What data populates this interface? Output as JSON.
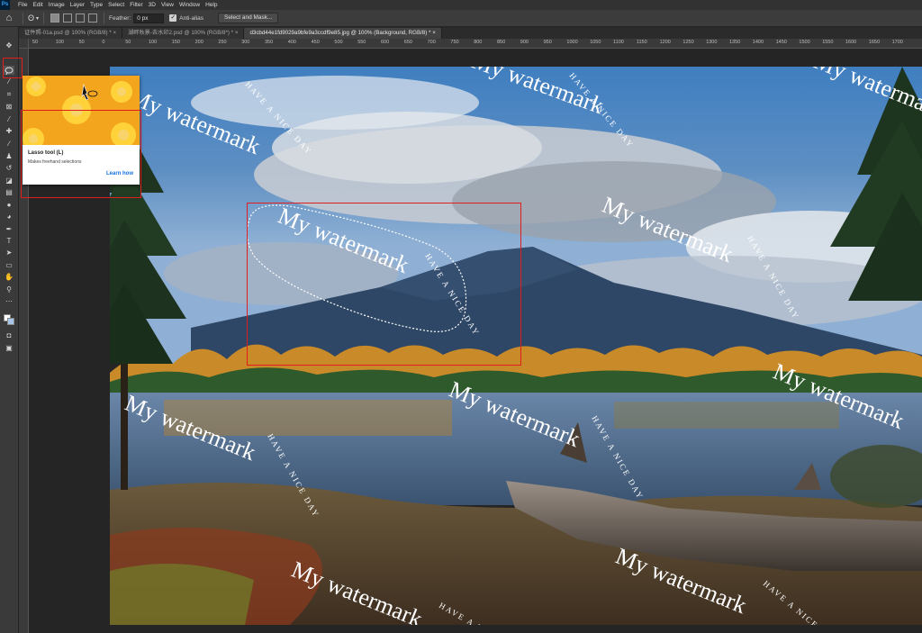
{
  "menubar": {
    "logo": "Ps",
    "items": [
      "File",
      "Edit",
      "Image",
      "Layer",
      "Type",
      "Select",
      "Filter",
      "3D",
      "View",
      "Window",
      "Help"
    ]
  },
  "options": {
    "feather_label": "Feather:",
    "feather_value": "0 px",
    "antialias_checked": true,
    "antialias_label": "Anti-alias",
    "select_mask_label": "Select and Mask..."
  },
  "tabs": [
    {
      "label": "证件照-01a.psd @ 100% (RGB/8) *",
      "active": false
    },
    {
      "label": "湖畔秋景-去水印2.psd @ 100% (RGB/8*) *",
      "active": false
    },
    {
      "label": "d3cbd44e1fd9029a9bfe9a3ccdf9e85.jpg @ 100% (Background, RGB/8) *",
      "active": true
    }
  ],
  "ruler_top": [
    "50",
    "100",
    "50",
    "0",
    "50",
    "100",
    "150",
    "200",
    "250",
    "300",
    "350",
    "400",
    "450",
    "500",
    "550",
    "600",
    "650",
    "700",
    "750",
    "800",
    "850",
    "900",
    "950",
    "1000",
    "1050",
    "1100",
    "1150",
    "1200",
    "1250",
    "1300",
    "1350",
    "1400",
    "1450",
    "1500",
    "1550",
    "1600",
    "1650",
    "1700"
  ],
  "tooltip": {
    "title": "Lasso tool (L)",
    "description": "Makes freehand selections",
    "link": "Learn how"
  },
  "watermark": {
    "main_text": "My watermark",
    "arc_text": "HAVE A NICE DAY"
  },
  "colors": {
    "foreground": "#ffffff",
    "background": "#a8c4e6",
    "highlight_box": "#e01e1e",
    "accent_link": "#1473e6"
  }
}
